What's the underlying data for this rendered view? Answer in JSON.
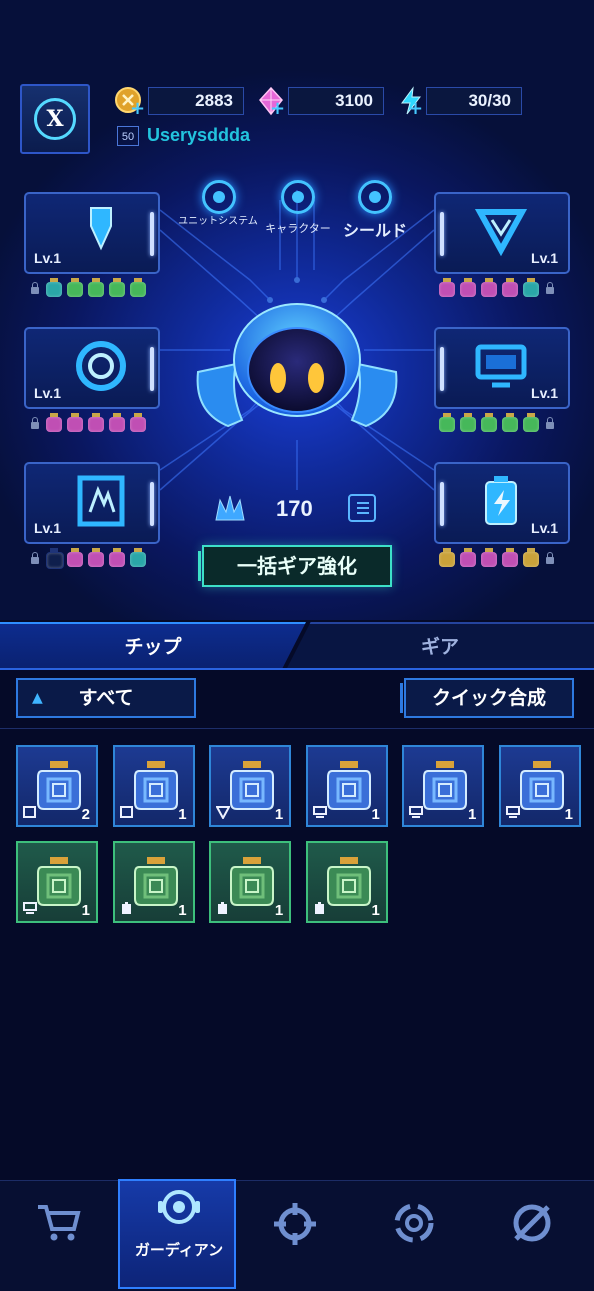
{
  "header": {
    "avatar_icon": "x-emblem-icon",
    "resources": [
      {
        "name": "gold-coin-icon",
        "value": "2883"
      },
      {
        "name": "pink-gem-icon",
        "value": "3100"
      },
      {
        "name": "energy-bolt-icon",
        "value": "30/30"
      }
    ],
    "level": "50",
    "username": "Userysddda"
  },
  "top_tabs": [
    {
      "label": "ユニットシステム",
      "icon": "unit-system-icon"
    },
    {
      "label": "キャラクター",
      "icon": "character-icon"
    },
    {
      "label": "シールド",
      "icon": "shield-icon"
    }
  ],
  "gear_slots": [
    {
      "side": "left",
      "icon": "weapon-icon",
      "level": "Lv.1",
      "sockets": [
        "lock",
        "#2aa7a8",
        "#46b85a",
        "#46b85a",
        "#46b85a",
        "#46b85a"
      ]
    },
    {
      "side": "right",
      "icon": "triangle-emblem-icon",
      "level": "Lv.1",
      "sockets": [
        "#c04fb4",
        "#c04fb4",
        "#c04fb4",
        "#c04fb4",
        "#2aa7a8",
        "lock"
      ]
    },
    {
      "side": "left",
      "icon": "radar-icon",
      "level": "Lv.1",
      "sockets": [
        "lock",
        "#c04fb4",
        "#c04fb4",
        "#c04fb4",
        "#c04fb4",
        "#c04fb4"
      ]
    },
    {
      "side": "right",
      "icon": "monitor-icon",
      "level": "Lv.1",
      "sockets": [
        "#46b85a",
        "#46b85a",
        "#46b85a",
        "#46b85a",
        "#46b85a",
        "lock"
      ]
    },
    {
      "side": "left",
      "icon": "chip-card-icon",
      "level": "Lv.1",
      "sockets": [
        "lock",
        "empty",
        "#c04fb4",
        "#c04fb4",
        "#c04fb4",
        "#2aa7a8"
      ]
    },
    {
      "side": "right",
      "icon": "battery-icon",
      "level": "Lv.1",
      "sockets": [
        "#caa23a",
        "#c04fb4",
        "#c04fb4",
        "#c04fb4",
        "#caa23a",
        "lock"
      ]
    }
  ],
  "power": {
    "icon": "power-crown-icon",
    "value": "170",
    "list_icon": "list-icon"
  },
  "enhance_button": "一括ギア強化",
  "tabs": {
    "chip": "チップ",
    "gear": "ギア"
  },
  "filter": {
    "label": "すべて",
    "caret": "▲"
  },
  "quick_button": "クイック合成",
  "chips": [
    {
      "color": "blue",
      "slot_icon": "chip-card-icon",
      "count": "2"
    },
    {
      "color": "blue",
      "slot_icon": "chip-card-icon",
      "count": "1"
    },
    {
      "color": "blue",
      "slot_icon": "triangle-emblem-icon",
      "count": "1"
    },
    {
      "color": "blue",
      "slot_icon": "monitor-icon",
      "count": "1"
    },
    {
      "color": "blue",
      "slot_icon": "monitor-icon",
      "count": "1"
    },
    {
      "color": "blue",
      "slot_icon": "monitor-icon",
      "count": "1"
    },
    {
      "color": "green",
      "slot_icon": "monitor-icon",
      "count": "1"
    },
    {
      "color": "green",
      "slot_icon": "battery-icon",
      "count": "1"
    },
    {
      "color": "green",
      "slot_icon": "battery-icon",
      "count": "1"
    },
    {
      "color": "green",
      "slot_icon": "battery-icon",
      "count": "1"
    }
  ],
  "nav": [
    {
      "icon": "cart-icon",
      "label": ""
    },
    {
      "icon": "guardian-icon",
      "label": "ガーディアン",
      "active": true
    },
    {
      "icon": "crosshair-icon",
      "label": ""
    },
    {
      "icon": "vortex-icon",
      "label": ""
    },
    {
      "icon": "slashed-orb-icon",
      "label": ""
    }
  ],
  "colors": {
    "accent": "#2f7fff",
    "username": "#23c4de",
    "enhance": "#3de0c8"
  }
}
